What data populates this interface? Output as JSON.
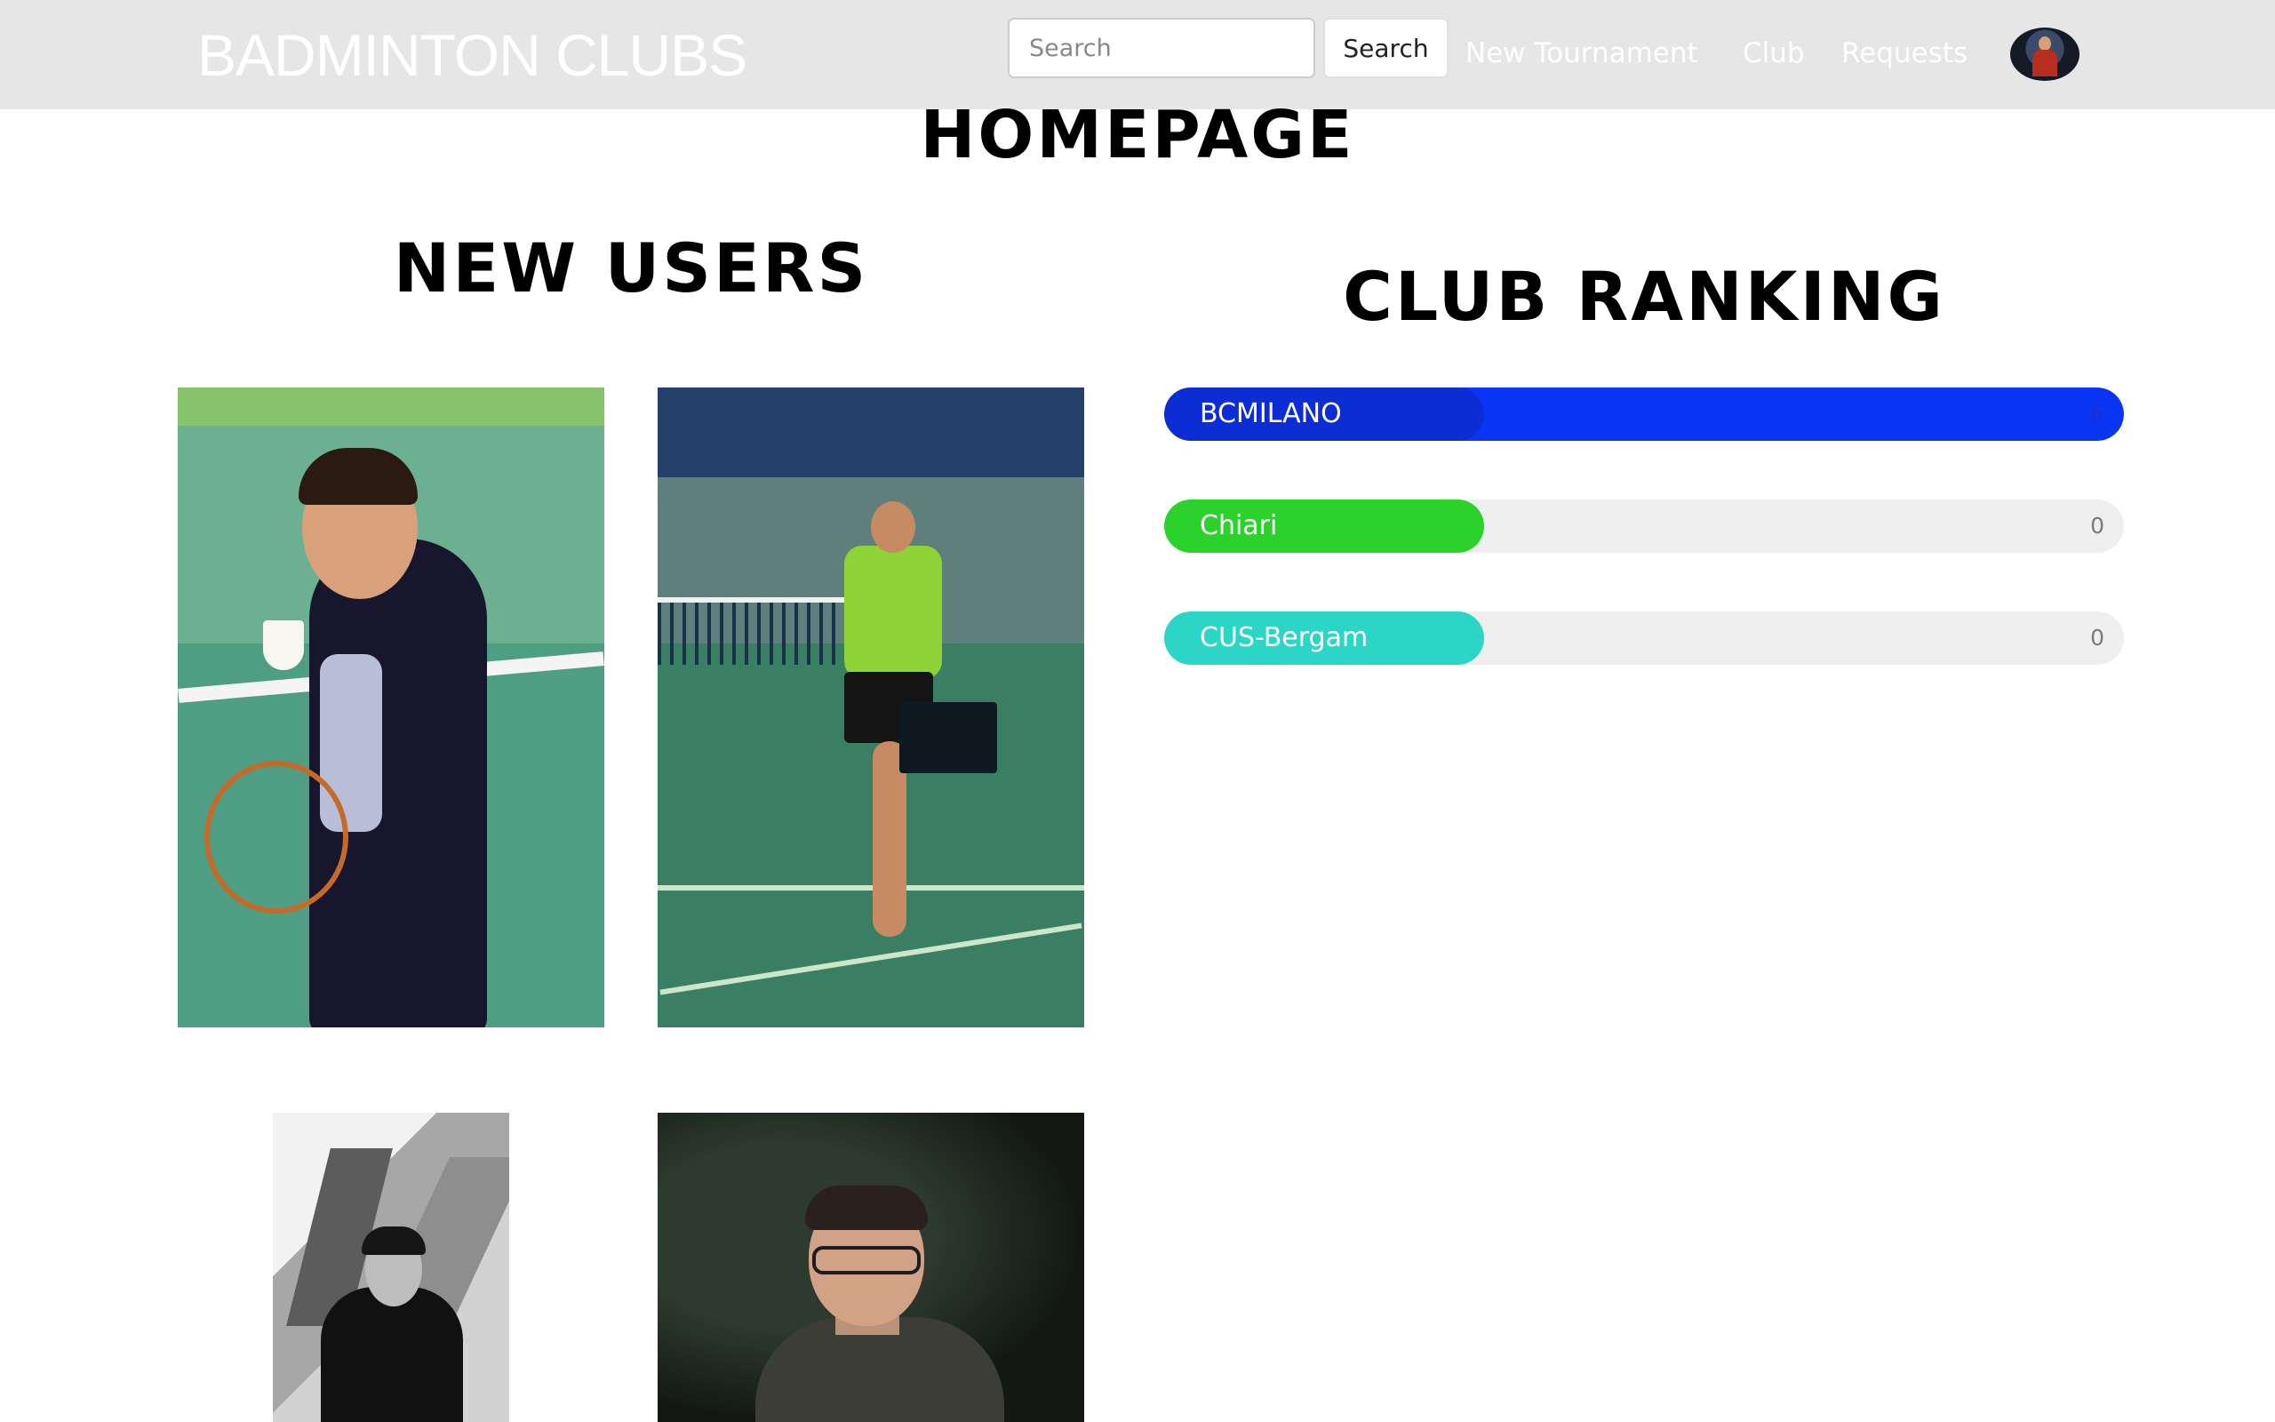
{
  "navbar": {
    "brand": "BADMINTON CLUBS",
    "search_placeholder": "Search",
    "search_button": "Search",
    "links": {
      "new_tournament": "New Tournament",
      "club": "Club",
      "requests": "Requests"
    }
  },
  "page": {
    "title": "HOMEPAGE"
  },
  "new_users": {
    "title": "NEW USERS"
  },
  "club_ranking": {
    "title": "CLUB RANKING",
    "max_value": 6,
    "clubs": [
      {
        "name": "BCMILANO",
        "value": "6",
        "bar_color": "#0b35f5",
        "label_color": "#0d2dd4"
      },
      {
        "name": "Chiari",
        "value": "0",
        "bar_color": "#2bd22b",
        "label_color": "#2bd22b"
      },
      {
        "name": "CUS-Bergam",
        "value": "0",
        "bar_color": "#2bd6c6",
        "label_color": "#2bd6c6"
      }
    ]
  }
}
